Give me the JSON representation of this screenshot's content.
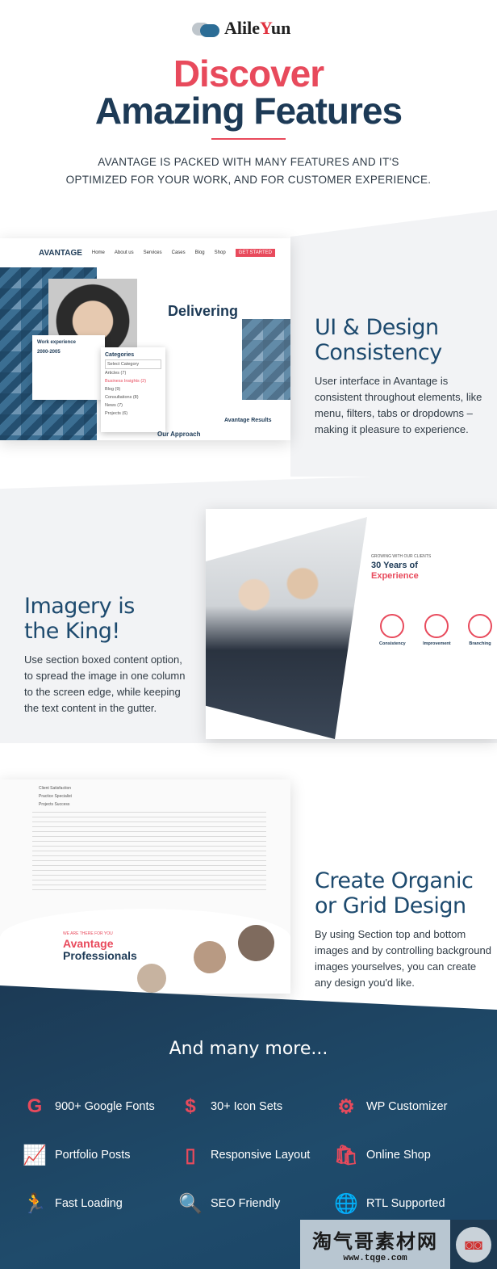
{
  "logo": {
    "text_a": "Alile",
    "text_y": "Y",
    "text_b": "un"
  },
  "header": {
    "title_line1": "Discover",
    "title_line2": "Amazing Features",
    "subtitle_line1": "AVANTAGE IS PACKED WITH MANY FEATURES AND IT'S",
    "subtitle_line2": "OPTIMIZED FOR YOUR WORK, AND FOR CUSTOMER EXPERIENCE."
  },
  "sections": [
    {
      "title_line1": "UI & Design",
      "title_line2": "Consistency",
      "text": "User interface in Avantage is consistent throughout elements, like menu, filters, tabs or dropdowns – making it pleasure to experience.",
      "shot": {
        "brand": "AVANTAGE",
        "nav": [
          "Home",
          "About us",
          "Services",
          "Cases",
          "Blog",
          "Shop"
        ],
        "cta": "GET STARTED",
        "heading": "Delivering",
        "categories_title": "Categories",
        "category_select": "Select Category",
        "categories": [
          "Articles (7)",
          "Business Insights (2)",
          "Blog (9)",
          "Consultations (8)",
          "News (7)",
          "Projects (6)"
        ],
        "work_title": "Work experience",
        "years": "2000-2005",
        "approach": "Our Approach",
        "results": "Avantage Results"
      }
    },
    {
      "title_line1": "Imagery is",
      "title_line2": "the King!",
      "text": "Use section boxed content option, to spread the image in one column to the screen edge, while keeping the text content in the gutter.",
      "shot": {
        "kicker": "GROWING WITH OUR CLIENTS",
        "heading_line1": "30 Years of",
        "heading_line2": "Experience",
        "circles": [
          "Consistency",
          "Improvement",
          "Branching"
        ]
      }
    },
    {
      "title_line1": "Create Organic",
      "title_line2": "or Grid Design",
      "text": "By using Section top and bottom images and by controlling background images yourselves, you can create any design you'd like.",
      "shot": {
        "kicker": "WE ARE THERE FOR YOU",
        "heading_line1": "Avantage",
        "heading_line2": "Professionals",
        "tabs": [
          "Client Satisfaction",
          "Practice Specialist",
          "Projects Success"
        ]
      }
    }
  ],
  "more": {
    "title": "And many more...",
    "features": [
      {
        "label": "900+ Google Fonts",
        "icon": "google-icon",
        "glyph": "G"
      },
      {
        "label": "30+ Icon Sets",
        "icon": "dollar-hand-icon",
        "glyph": "$"
      },
      {
        "label": "WP Customizer",
        "icon": "gears-icon",
        "glyph": "⚙"
      },
      {
        "label": "Portfolio Posts",
        "icon": "presentation-icon",
        "glyph": "📈"
      },
      {
        "label": "Responsive Layout",
        "icon": "mobile-icon",
        "glyph": "▯"
      },
      {
        "label": "Online Shop",
        "icon": "shopping-bag-icon",
        "glyph": "🛍"
      },
      {
        "label": "Fast Loading",
        "icon": "running-man-icon",
        "glyph": "🏃"
      },
      {
        "label": "SEO Friendly",
        "icon": "magnifier-icon",
        "glyph": "🔍"
      },
      {
        "label": "RTL Supported",
        "icon": "globe-icon",
        "glyph": "🌐"
      }
    ]
  },
  "watermark": {
    "text": "淘气哥素材网",
    "url": "www.tqge.com"
  },
  "colors": {
    "accent": "#e84a5c",
    "navy": "#1d3a56"
  }
}
